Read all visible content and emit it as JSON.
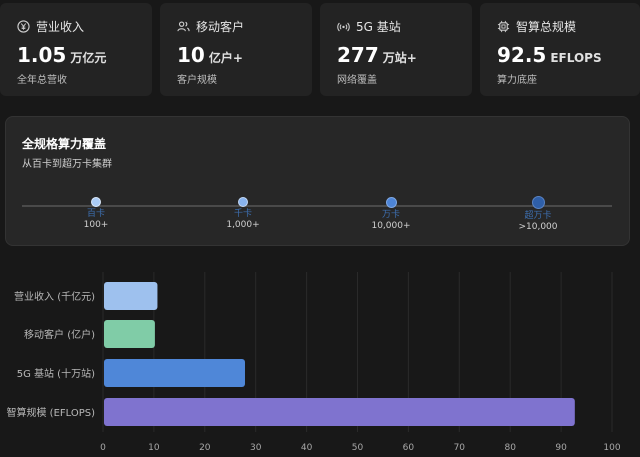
{
  "cards": [
    {
      "icon": "yuan-icon",
      "label": "营业收入",
      "value": "1.05",
      "unit": "万亿元",
      "sub": "全年总营收"
    },
    {
      "icon": "users-icon",
      "label": "移动客户",
      "value": "10",
      "unit": "亿户+",
      "sub": "客户规模"
    },
    {
      "icon": "signal-icon",
      "label": "5G 基站",
      "value": "277",
      "unit": "万站+",
      "sub": "网络覆盖"
    },
    {
      "icon": "chip-icon",
      "label": "智算总规模",
      "value": "92.5",
      "unit": "EFLOPS",
      "sub": "算力底座"
    }
  ],
  "coverage": {
    "title": "全规格算力覆盖",
    "subtitle": "从百卡到超万卡集群",
    "stops": [
      {
        "name": "百卡",
        "count": "100+"
      },
      {
        "name": "千卡",
        "count": "1,000+"
      },
      {
        "name": "万卡",
        "count": "10,000+"
      },
      {
        "name": "超万卡",
        "count": ">10,000"
      }
    ]
  },
  "colors": {
    "bar1": "#9ec1ee",
    "bar2": "#80cca7",
    "bar3": "#4f87d8",
    "bar4": "#7f73cf"
  },
  "chart_data": {
    "type": "bar",
    "orientation": "horizontal",
    "categories": [
      "营业收入 (千亿元)",
      "移动客户 (亿户)",
      "5G 基站 (十万站)",
      "智算规模 (EFLOPS)"
    ],
    "values": [
      10.5,
      10,
      27.7,
      92.5
    ],
    "xlim": [
      0,
      100
    ],
    "xticks": [
      0,
      10,
      20,
      30,
      40,
      50,
      60,
      70,
      80,
      90,
      100
    ],
    "grid": true
  }
}
